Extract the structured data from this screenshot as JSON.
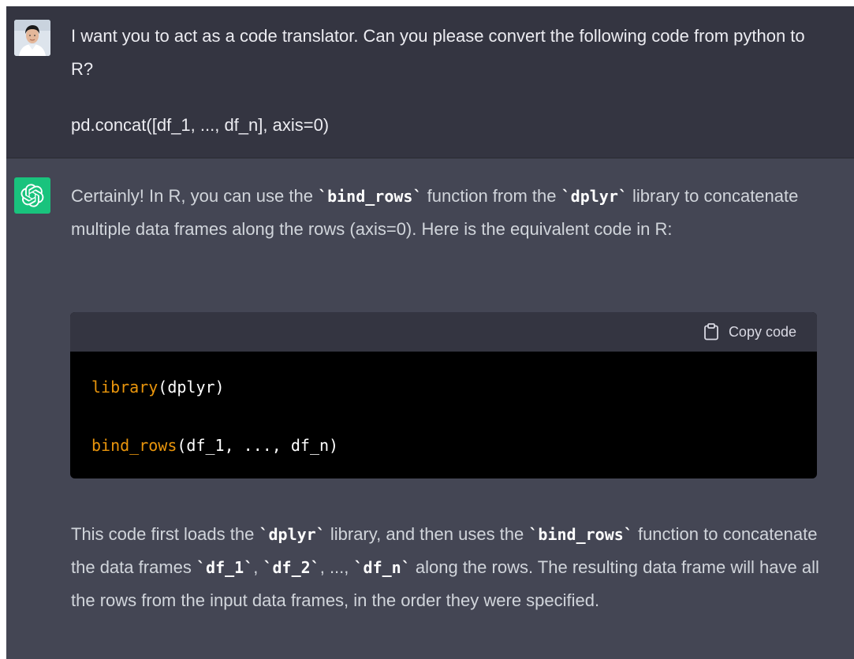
{
  "user_message": {
    "line1": "I want you to act as a code translator. Can you please convert the following code from python to R?",
    "line2": "pd.concat([df_1, ..., df_n], axis=0)"
  },
  "assistant_message": {
    "para1": {
      "t1": "Certainly! In R, you can use the ",
      "c1": "`bind_rows`",
      "t2": " function from the ",
      "c2": "`dplyr`",
      "t3": " library to concatenate multiple data frames along the rows (axis=0). Here is the equivalent code in R:"
    },
    "code_block": {
      "copy_label": "Copy code",
      "line1_fn": "library",
      "line1_rest": "(dplyr)",
      "line2_fn": "bind_rows",
      "line2_rest": "(df_1, ..., df_n)"
    },
    "para2": {
      "t1": "This code first loads the ",
      "c1": "`dplyr`",
      "t2": " library, and then uses the ",
      "c2": "`bind_rows`",
      "t3": " function to concatenate the data frames ",
      "c3": "`df_1`",
      "t4": ", ",
      "c4": "`df_2`",
      "t5": ", ..., ",
      "c5": "`df_n`",
      "t6": " along the rows. The resulting data frame will have all the rows from the input data frames, in the order they were specified."
    }
  },
  "icons": {
    "user_avatar": "user-avatar-photo",
    "assistant_avatar": "openai-logo-icon",
    "copy": "clipboard-icon"
  },
  "colors": {
    "user_bg": "#343541",
    "assistant_bg": "#444654",
    "gpt_green": "#19c37d",
    "code_keyword": "#e9950c"
  }
}
